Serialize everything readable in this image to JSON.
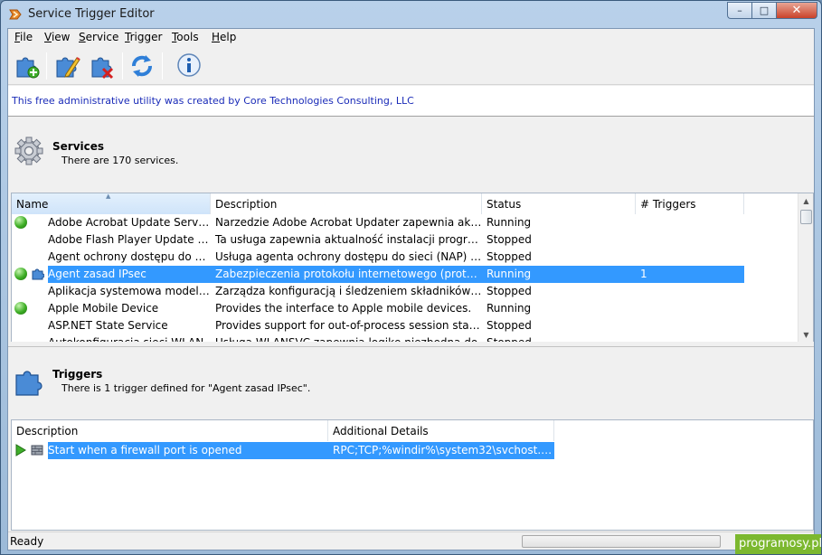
{
  "window": {
    "title": "Service Trigger Editor",
    "min_glyph": "–",
    "max_glyph": "□",
    "close_glyph": "✕"
  },
  "menu": [
    {
      "underline": "F",
      "rest": "ile"
    },
    {
      "underline": "V",
      "rest": "iew"
    },
    {
      "underline": "S",
      "rest": "ervice"
    },
    {
      "underline": "T",
      "rest": "rigger"
    },
    {
      "underline": "T",
      "rest": "ools"
    },
    {
      "underline": "H",
      "rest": "elp"
    }
  ],
  "toolbar": {
    "buttons": [
      "add-trigger-icon",
      "edit-trigger-icon",
      "delete-trigger-icon",
      "refresh-icon",
      "about-icon"
    ]
  },
  "info_bar": "This free administrative utility was created by Core Technologies Consulting, LLC",
  "services": {
    "title": "Services",
    "subtitle": "There are 170 services.",
    "columns": [
      "Name",
      "Description",
      "Status",
      "# Triggers"
    ],
    "rows": [
      {
        "name": "Adobe Acrobat Update Service",
        "description": "Narzedzie Adobe Acrobat Updater zapewnia aktualn...",
        "status": "Running",
        "triggers": "",
        "running": true,
        "has_trigger": false,
        "selected": false
      },
      {
        "name": "Adobe Flash Player Update Serv...",
        "description": "Ta usługa zapewnia aktualność instalacji programu A...",
        "status": "Stopped",
        "triggers": "",
        "running": false,
        "has_trigger": false,
        "selected": false
      },
      {
        "name": "Agent ochrony dostępu do sieci",
        "description": "Usługa agenta ochrony dostępu do sieci (NAP) zbier...",
        "status": "Stopped",
        "triggers": "",
        "running": false,
        "has_trigger": false,
        "selected": false
      },
      {
        "name": "Agent zasad IPsec",
        "description": "Zabezpieczenia protokołu internetowego (protokół I...",
        "status": "Running",
        "triggers": "1",
        "running": true,
        "has_trigger": true,
        "selected": true
      },
      {
        "name": "Aplikacja systemowa modelu C...",
        "description": "Zarządza konfiguracją i śledzeniem składników opart...",
        "status": "Stopped",
        "triggers": "",
        "running": false,
        "has_trigger": false,
        "selected": false
      },
      {
        "name": "Apple Mobile Device",
        "description": "Provides the interface to Apple mobile devices.",
        "status": "Running",
        "triggers": "",
        "running": true,
        "has_trigger": false,
        "selected": false
      },
      {
        "name": "ASP.NET State Service",
        "description": "Provides support for out-of-process session states fo...",
        "status": "Stopped",
        "triggers": "",
        "running": false,
        "has_trigger": false,
        "selected": false
      },
      {
        "name": "Autokonfiguracja sieci WLAN",
        "description": "Usługa WLANSVC zapewnia logikę niezbędną do",
        "status": "Stopped",
        "triggers": "",
        "running": false,
        "has_trigger": false,
        "selected": false
      }
    ]
  },
  "triggers": {
    "title": "Triggers",
    "subtitle": "There is 1 trigger defined for \"Agent zasad IPsec\".",
    "columns": [
      "Description",
      "Additional Details"
    ],
    "rows": [
      {
        "description": "Start when a firewall port is opened",
        "details": "RPC;TCP;%windir%\\system32\\svchost.exe;...",
        "selected": true
      }
    ]
  },
  "status_bar": "Ready",
  "watermark": "programosy.pl"
}
